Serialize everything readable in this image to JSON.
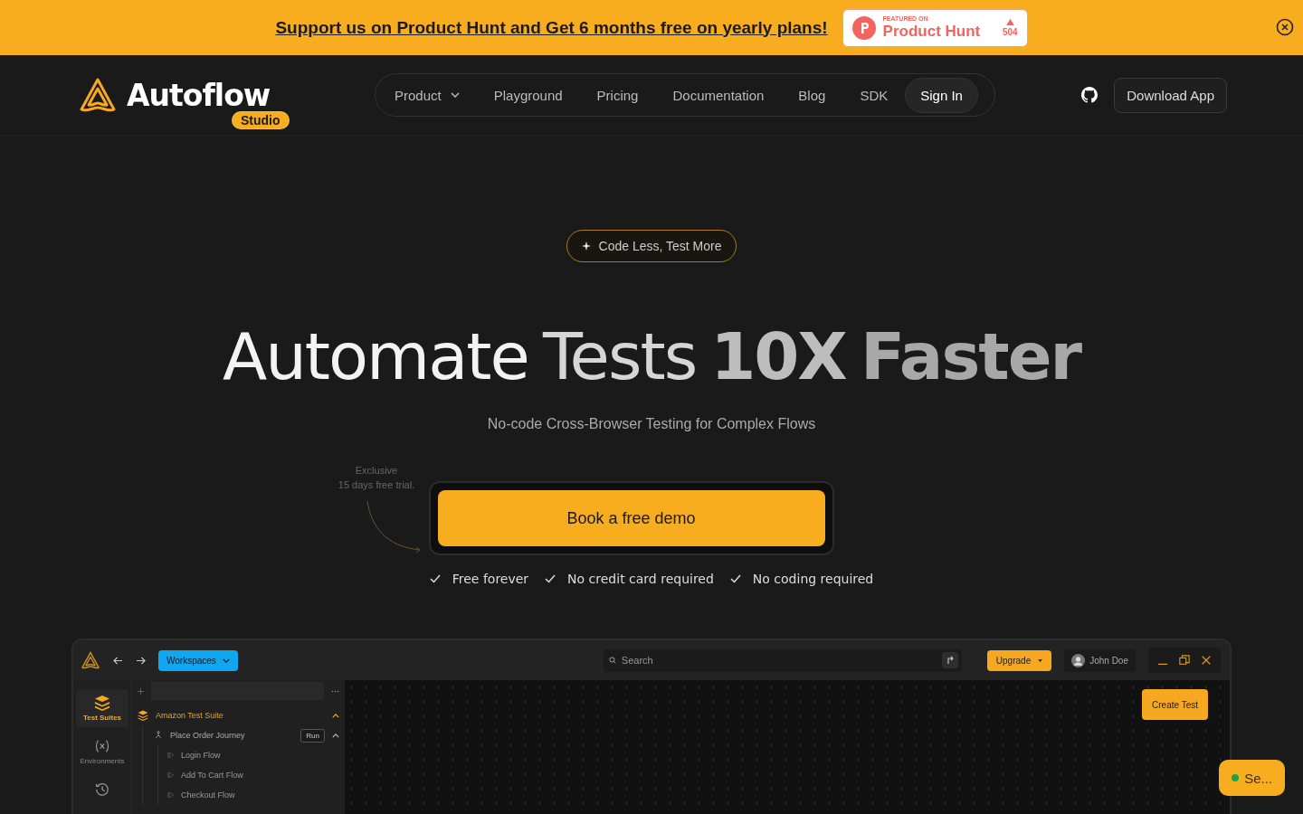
{
  "banner": {
    "text": "Support us on Product Hunt and Get 6 months free on yearly plans!",
    "badge": {
      "featured": "FEATURED ON",
      "name": "Product Hunt",
      "votes": "504"
    }
  },
  "header": {
    "logo": "Autoflow",
    "logo_tag": "Studio",
    "nav": [
      {
        "label": "Product",
        "kind": "menu"
      },
      {
        "label": "Playground",
        "kind": "link"
      },
      {
        "label": "Pricing",
        "kind": "link"
      },
      {
        "label": "Documentation",
        "kind": "link"
      },
      {
        "label": "Blog",
        "kind": "link"
      },
      {
        "label": "SDK",
        "kind": "link"
      },
      {
        "label": "Sign In",
        "kind": "button"
      }
    ],
    "download": "Download App"
  },
  "hero": {
    "pill": "Code Less, Test More",
    "title": [
      "Automate",
      "Tests",
      "10X",
      "Faster"
    ],
    "subtitle": "No-code Cross-Browser Testing for Complex Flows",
    "note": [
      "Exclusive",
      "15 days free trial."
    ],
    "cta": "Book a free demo",
    "checks": [
      "Free forever",
      "No credit card required",
      "No coding required"
    ]
  },
  "app": {
    "workspace": "Workspaces",
    "search": {
      "placeholder": "Search"
    },
    "upgrade": "Upgrade",
    "user": "John Doe",
    "create": "Create Test",
    "rail": [
      {
        "label": "Test Suites",
        "selected": true
      },
      {
        "label": "Environments",
        "selected": false
      },
      {
        "selected": false
      }
    ],
    "tree": [
      {
        "label": "Amazon Test Suite",
        "expanded": true,
        "children": [
          {
            "label": "Place Order Journey",
            "expanded": true,
            "action": "Run",
            "children": [
              {
                "label": "Login Flow"
              },
              {
                "label": "Add To Cart Flow"
              },
              {
                "label": "Checkout Flow"
              }
            ]
          }
        ]
      }
    ]
  },
  "chat": {
    "label": "Se...",
    "color": "#16a34a"
  }
}
